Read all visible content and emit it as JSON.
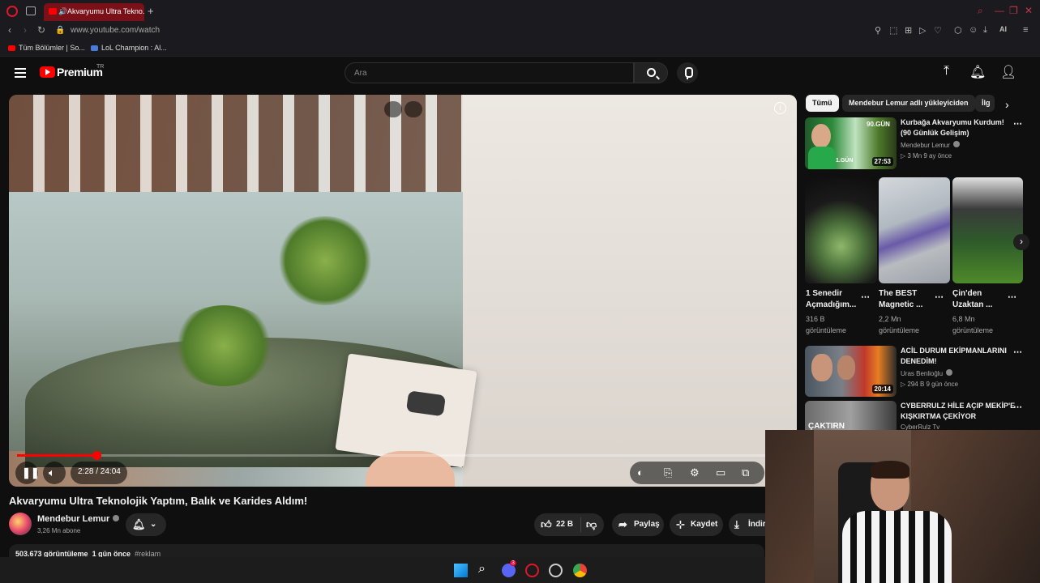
{
  "browser": {
    "tab_title": "Akvaryumu Ultra Tekno...",
    "new_tab": "+",
    "url": "www.youtube.com/watch",
    "ai_label": "AI",
    "bookmarks": [
      "Tüm Bölümler | So...",
      "LoL Champion : Al..."
    ]
  },
  "youtube": {
    "logo_text": "Premium",
    "region": "TR",
    "search_placeholder": "Ara"
  },
  "video": {
    "title": "Akvaryumu Ultra Teknolojik Yaptım, Balık ve Karides Aldım!",
    "current_time": "2:28",
    "duration": "24:04",
    "time_display": "2:28 / 24:04",
    "progress": 0.103
  },
  "channel": {
    "name": "Mendebur Lemur",
    "subscribers": "3,26 Mn abone"
  },
  "actions": {
    "likes": "22 B",
    "share": "Paylaş",
    "save": "Kaydet",
    "download": "İndir"
  },
  "description": {
    "views": "503.673 görüntüleme",
    "age": "1 gün önce",
    "tag": "#reklam"
  },
  "sidebar": {
    "chips": [
      "Tümü",
      "Mendebur Lemur adlı yükleyiciden",
      "İlg"
    ],
    "recommended": [
      {
        "title_line1": "Kurbağa Akvaryumu Kurdum!",
        "title_line2": "(90 Günlük Gelişim)",
        "channel": "Mendebur Lemur",
        "stats": "3 Mn  9 ay önce",
        "duration": "27:53",
        "thumb_overlay_top": "90.GÜN",
        "thumb_overlay_bottom": "1.GÜN"
      },
      {
        "title_line1": "ACİL DURUM EKİPMANLARINI",
        "title_line2": "DENEDİM!",
        "channel": "Uras Benlioğlu",
        "stats": "294 B  9 gün önce",
        "duration": "20:14"
      },
      {
        "title_line1": "CYBERRULZ HİLE AÇIP MEKİP'E",
        "title_line2": "KIŞKIRTMA ÇEKİYOR",
        "channel": "CyberRulz Tv",
        "thumb_overlay_top": "ÇAKTIRN"
      }
    ],
    "shorts": [
      {
        "title_line1": "1 Senedir",
        "title_line2": "Açmadığım...",
        "views_line1": "316 B",
        "views_line2": "görüntüleme"
      },
      {
        "title_line1": "The BEST",
        "title_line2": "Magnetic ...",
        "views_line1": "2,2 Mn",
        "views_line2": "görüntüleme"
      },
      {
        "title_line1": "Çin'den",
        "title_line2": "Uzaktan ...",
        "views_line1": "6,8 Mn",
        "views_line2": "görüntüleme"
      }
    ]
  },
  "taskbar": {
    "discord_badge": "3"
  },
  "colors": {
    "youtube_red": "#ff0000",
    "opera_red": "#e0162b",
    "active_tab": "#7a1018",
    "background": "#0f0f0f"
  }
}
